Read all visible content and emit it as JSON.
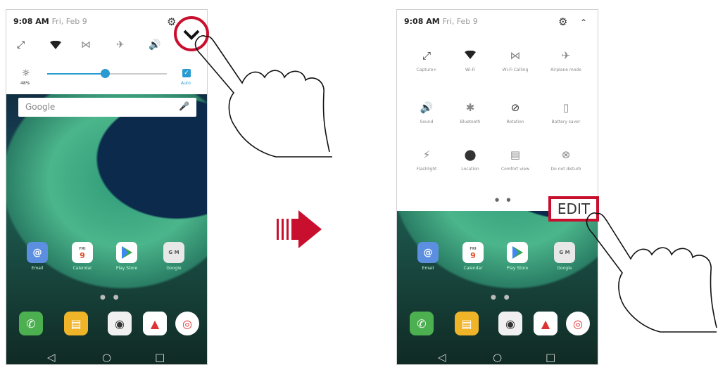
{
  "left_phone": {
    "status_time": "9:08 AM",
    "status_date": "Fri, Feb 9",
    "brightness_level": 0.48,
    "brightness_label": "48%",
    "auto_label": "Auto",
    "search_placeholder": "Google",
    "apps": [
      {
        "label": "Email",
        "icon": "email-icon"
      },
      {
        "label": "Calendar",
        "icon": "calendar-icon",
        "day_name": "FRI",
        "day_num": "9"
      },
      {
        "label": "Play Store",
        "icon": "play-store-icon"
      },
      {
        "label": "Google",
        "icon": "google-folder-icon"
      }
    ]
  },
  "right_phone": {
    "status_time": "9:08 AM",
    "status_date": "Fri, Feb 9",
    "tiles": [
      {
        "label": "Capture+",
        "icon": "capture-icon"
      },
      {
        "label": "Wi-Fi",
        "icon": "wifi-icon"
      },
      {
        "label": "Wi-Fi Calling",
        "icon": "wifi-calling-icon"
      },
      {
        "label": "Airplane mode",
        "icon": "airplane-icon"
      },
      {
        "label": "Sound",
        "icon": "sound-icon"
      },
      {
        "label": "Bluetooth",
        "icon": "bluetooth-icon"
      },
      {
        "label": "Rotation",
        "icon": "rotation-icon"
      },
      {
        "label": "Battery saver",
        "icon": "battery-saver-icon"
      },
      {
        "label": "Flashlight",
        "icon": "flashlight-icon"
      },
      {
        "label": "Location",
        "icon": "location-icon"
      },
      {
        "label": "Comfort view",
        "icon": "comfort-view-icon"
      },
      {
        "label": "Do not disturb",
        "icon": "do-not-disturb-icon"
      }
    ],
    "edit_label": "EDIT",
    "apps": [
      {
        "label": "Email",
        "icon": "email-icon"
      },
      {
        "label": "Calendar",
        "icon": "calendar-icon",
        "day_name": "FRI",
        "day_num": "9"
      },
      {
        "label": "Play Store",
        "icon": "play-store-icon"
      },
      {
        "label": "Google",
        "icon": "google-folder-icon"
      }
    ]
  },
  "colors": {
    "highlight": "#c8102e",
    "accent": "#2a9bd0"
  }
}
